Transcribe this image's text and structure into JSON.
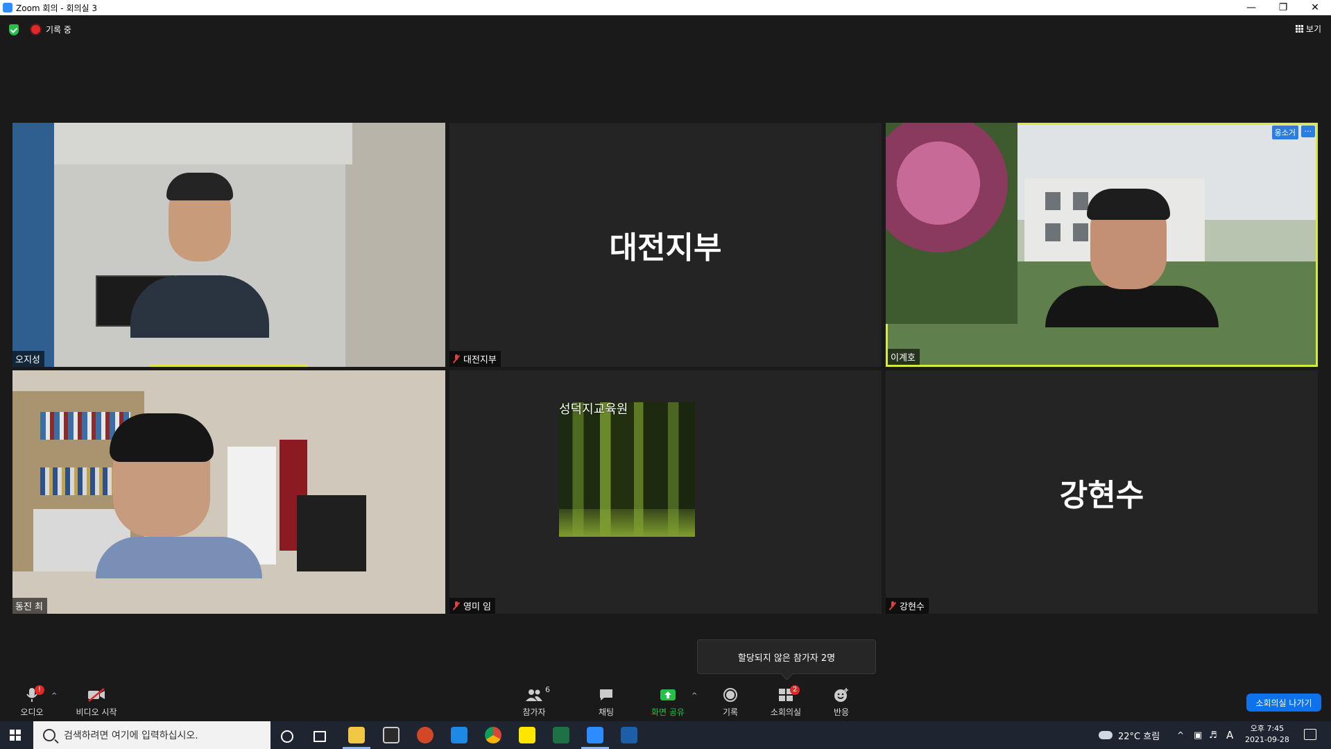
{
  "window": {
    "title": "Zoom 회의 - 회의실 3"
  },
  "topbar": {
    "recording_label": "기록 중",
    "view_label": "보기"
  },
  "tiles": [
    {
      "name": "오지성",
      "muted": false
    },
    {
      "name": "대전지부",
      "big_name": "대전지부",
      "muted": true
    },
    {
      "name": "이계호",
      "muted": false,
      "record_tag": "옹소거",
      "more_tag": "···"
    },
    {
      "name": "동진 최",
      "muted": false
    },
    {
      "name": "영미 임",
      "muted": true,
      "image_caption": "성덕지교육원"
    },
    {
      "name": "강현수",
      "big_name": "강현수",
      "muted": true
    }
  ],
  "tooltip": {
    "text": "할당되지 않은 참가자 2명"
  },
  "toolbar": {
    "audio_label": "오디오",
    "video_label": "비디오 시작",
    "participants_label": "참가자",
    "participants_count": "6",
    "chat_label": "채팅",
    "share_label": "화면 공유",
    "record_label": "기록",
    "breakout_label": "소회의실",
    "breakout_badge": "2",
    "reactions_label": "반응",
    "leave_label": "소회의실 나가기",
    "audio_badge": "!"
  },
  "taskbar": {
    "search_placeholder": "검색하려면 여기에 입력하십시오.",
    "weather": "22°C 흐림",
    "ime": "A",
    "time": "오후 7:45",
    "date": "2021-09-28"
  },
  "colors": {
    "active_border": "#d7ec3a",
    "share_green": "#24c14a",
    "leave_blue": "#0e72ed"
  }
}
